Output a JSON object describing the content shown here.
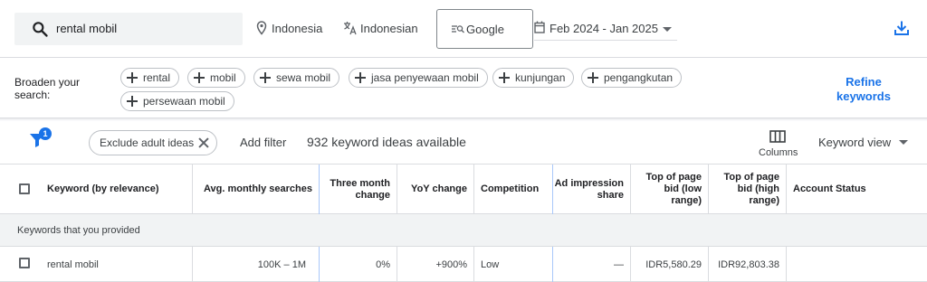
{
  "search": {
    "query": "rental mobil"
  },
  "location": "Indonesia",
  "language": "Indonesian",
  "network": "Google",
  "date_range": "Feb 2024 - Jan 2025",
  "broaden": {
    "label": "Broaden your search:",
    "chips": [
      "rental",
      "mobil",
      "sewa mobil",
      "jasa penyewaan mobil",
      "kunjungan",
      "pengangkutan",
      "persewaan mobil"
    ],
    "refine_label": "Refine keywords"
  },
  "filterbar": {
    "filter_count": "1",
    "exclude_chip": "Exclude adult ideas",
    "add_filter": "Add filter",
    "ideas_count": "932 keyword ideas available",
    "columns_label": "Columns",
    "view_label": "Keyword view"
  },
  "table": {
    "headers": {
      "keyword": "Keyword (by relevance)",
      "avg": "Avg. monthly searches",
      "three": "Three month change",
      "yoy": "YoY change",
      "competition": "Competition",
      "impression": "Ad impression share",
      "bid_low": "Top of page bid (low range)",
      "bid_high": "Top of page bid (high range)",
      "status": "Account Status"
    },
    "section_label": "Keywords that you provided",
    "rows": [
      {
        "keyword": "rental mobil",
        "avg": "100K – 1M",
        "three": "0%",
        "yoy": "+900%",
        "competition": "Low",
        "impression": "—",
        "bid_low": "IDR5,580.29",
        "bid_high": "IDR92,803.38",
        "status": ""
      }
    ]
  },
  "colors": {
    "accent": "#1a73e8",
    "border": "#dadce0",
    "section_bg": "#f1f3f4"
  }
}
